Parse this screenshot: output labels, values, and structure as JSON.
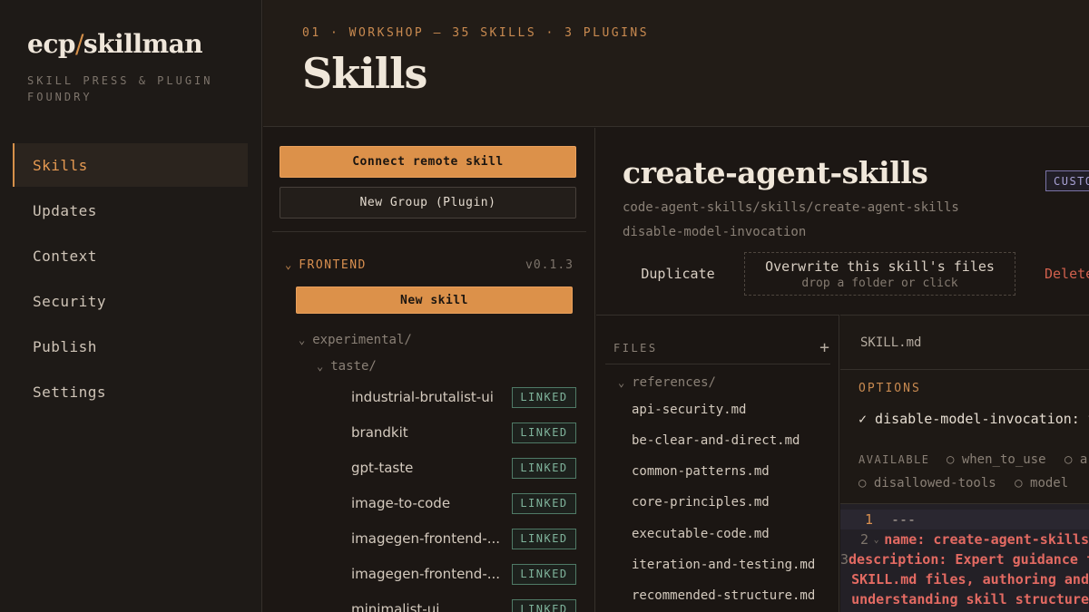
{
  "brand": {
    "left": "ecp",
    "slash": "/",
    "right": "skillman",
    "tagline": "SKILL PRESS & PLUGIN FOUNDRY"
  },
  "nav": [
    {
      "label": "Skills",
      "active": true
    },
    {
      "label": "Updates"
    },
    {
      "label": "Context"
    },
    {
      "label": "Security"
    },
    {
      "label": "Publish"
    },
    {
      "label": "Settings"
    }
  ],
  "header": {
    "eyebrow": "01 · WORKSHOP — 35 SKILLS · 3 PLUGINS",
    "title": "Skills"
  },
  "groups": {
    "connect_label": "Connect remote skill",
    "new_group_label": "New Group (Plugin)",
    "group": {
      "name": "FRONTEND",
      "version": "v0.1.3",
      "new_skill_label": "New skill"
    },
    "folders": [
      "experimental/",
      "taste/"
    ],
    "skills": [
      {
        "name": "industrial-brutalist-ui",
        "badge": "LINKED"
      },
      {
        "name": "brandkit",
        "badge": "LINKED"
      },
      {
        "name": "gpt-taste",
        "badge": "LINKED"
      },
      {
        "name": "image-to-code",
        "badge": "LINKED"
      },
      {
        "name": "imagegen-frontend-...",
        "badge": "LINKED"
      },
      {
        "name": "imagegen-frontend-...",
        "badge": "LINKED"
      },
      {
        "name": "minimalist-ui",
        "badge": "LINKED"
      }
    ]
  },
  "detail": {
    "title": "create-agent-skills",
    "badge": "CUSTOM",
    "path": "code-agent-skills/skills/create-agent-skills",
    "flag": "disable-model-invocation",
    "duplicate_label": "Duplicate",
    "overwrite_label": "Overwrite this skill's files",
    "overwrite_hint": "drop a folder or click",
    "delete_label": "Delete"
  },
  "files": {
    "header": "FILES",
    "add_icon": "+",
    "folder": "references/",
    "items": [
      "api-security.md",
      "be-clear-and-direct.md",
      "common-patterns.md",
      "core-principles.md",
      "executable-code.md",
      "iteration-and-testing.md",
      "recommended-structure.md"
    ]
  },
  "editor": {
    "tab": "SKILL.md",
    "options_label": "OPTIONS",
    "checked_option": "✓ disable-model-invocation: true",
    "available_label": "AVAILABLE",
    "available": [
      "○ when_to_use",
      "○ argument-hint",
      "○ disallowed-tools",
      "○ model"
    ],
    "code": [
      {
        "n": "1",
        "text": "---"
      },
      {
        "n": "2",
        "text": "name: create-agent-skills"
      },
      {
        "n": "3",
        "text": "description: Expert guidance for"
      },
      {
        "n": "",
        "text": "SKILL.md files, authoring and"
      },
      {
        "n": "",
        "text": "understanding skill structure"
      }
    ]
  },
  "colors": {
    "accent": "#dc914a",
    "linked": "#7fb39b",
    "danger": "#d0604d",
    "custom": "#a9a2d6"
  }
}
